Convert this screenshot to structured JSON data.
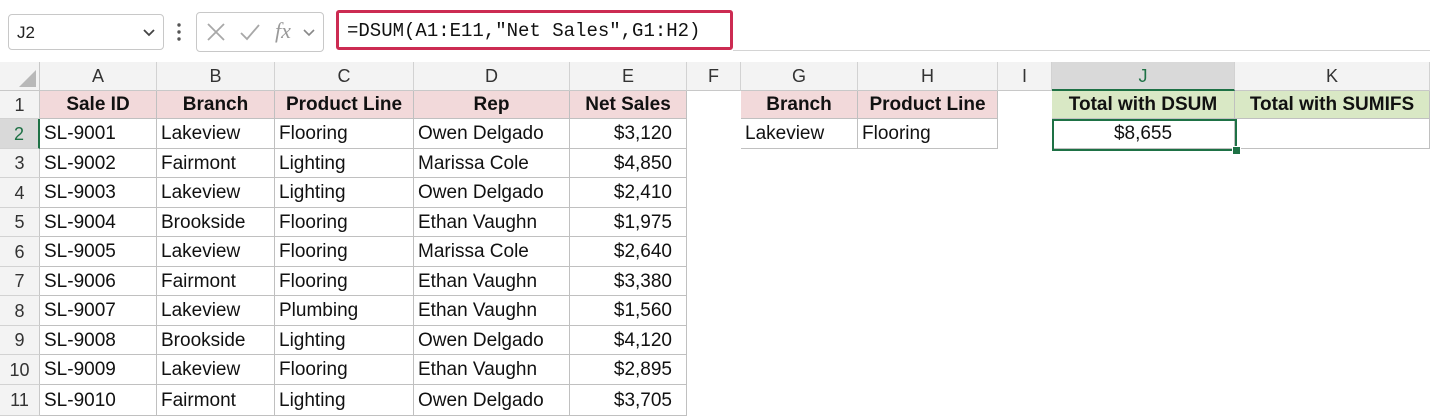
{
  "formula_bar": {
    "name_box": "J2",
    "fx_label": "fx",
    "formula": "=DSUM(A1:E11,\"Net Sales\",G1:H2)",
    "highlight_color": "#cc2b52"
  },
  "columns": [
    "A",
    "B",
    "C",
    "D",
    "E",
    "F",
    "G",
    "H",
    "I",
    "J",
    "K"
  ],
  "rows": [
    "1",
    "2",
    "3",
    "4",
    "5",
    "6",
    "7",
    "8",
    "9",
    "10",
    "11"
  ],
  "selection": {
    "column": "J",
    "row": "2",
    "accent": "#1e7145"
  },
  "table": {
    "headers": [
      "Sale ID",
      "Branch",
      "Product Line",
      "Rep",
      "Net Sales"
    ],
    "header_color": "#f2d9da",
    "rows": [
      [
        "SL-9001",
        "Lakeview",
        "Flooring",
        "Owen Delgado",
        "$3,120"
      ],
      [
        "SL-9002",
        "Fairmont",
        "Lighting",
        "Marissa Cole",
        "$4,850"
      ],
      [
        "SL-9003",
        "Lakeview",
        "Lighting",
        "Owen Delgado",
        "$2,410"
      ],
      [
        "SL-9004",
        "Brookside",
        "Flooring",
        "Ethan Vaughn",
        "$1,975"
      ],
      [
        "SL-9005",
        "Lakeview",
        "Flooring",
        "Marissa Cole",
        "$2,640"
      ],
      [
        "SL-9006",
        "Fairmont",
        "Flooring",
        "Ethan Vaughn",
        "$3,380"
      ],
      [
        "SL-9007",
        "Lakeview",
        "Plumbing",
        "Ethan Vaughn",
        "$1,560"
      ],
      [
        "SL-9008",
        "Brookside",
        "Lighting",
        "Owen Delgado",
        "$4,120"
      ],
      [
        "SL-9009",
        "Lakeview",
        "Flooring",
        "Ethan Vaughn",
        "$2,895"
      ],
      [
        "SL-9010",
        "Fairmont",
        "Lighting",
        "Owen Delgado",
        "$3,705"
      ]
    ]
  },
  "criteria": {
    "headers": [
      "Branch",
      "Product Line"
    ],
    "values": [
      "Lakeview",
      "Flooring"
    ]
  },
  "results": {
    "headers": [
      "Total with DSUM",
      "Total with SUMIFS"
    ],
    "header_color": "#d9e8c5",
    "values": [
      "$8,655",
      ""
    ]
  }
}
